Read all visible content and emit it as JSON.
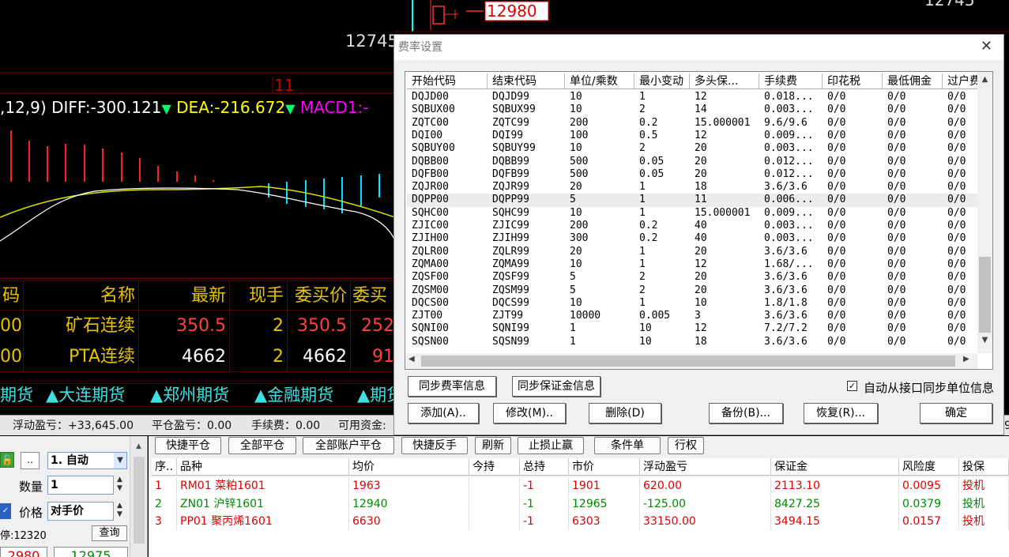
{
  "chart": {
    "price_label_top": "12745",
    "tick_label": "11",
    "top_marker": "12980",
    "top_right_value": "12745",
    "macd": {
      "params": ",12,9)",
      "diff": "DIFF:-300.121",
      "dea": "DEA:-216.672",
      "macd": "MACD1:-",
      "diff_color": "#ffffff",
      "dea_color": "#ffff00",
      "macd_color": "#ff00ff"
    }
  },
  "quotes": {
    "headers": [
      "码",
      "名称",
      "最新",
      "现手",
      "委买价",
      "委买"
    ],
    "rows": [
      {
        "code": "00",
        "name": "矿石连续",
        "last": "350.5",
        "hand": "2",
        "bid": "350.5",
        "bidvol": "252"
      },
      {
        "code": "00",
        "name": "PTA连续",
        "last": "4662",
        "hand": "2",
        "bid": "4662",
        "bidvol": "91"
      }
    ]
  },
  "exchanges": [
    "期货",
    "▲大连期货",
    "▲郑州期货",
    "▲金融期货",
    "▲期货"
  ],
  "status": {
    "float_pnl": "浮动盈亏：+33,645.00",
    "close_pnl": "平仓盈亏：0.00",
    "fee": "手续费：0.00",
    "available": "可用资金:",
    "tail": "9"
  },
  "order_panel": {
    "mode": "1. 自动",
    "qty_label": "数量",
    "qty_value": "1",
    "price_label": "价格",
    "price_value": "对手价",
    "limit_label": "停:12320",
    "query_button": "查询",
    "bid_price": "2980",
    "ask_price": "12975",
    "dots_button": ".."
  },
  "positions": {
    "buttons": [
      "快捷平仓",
      "全部平仓",
      "全部账户平仓",
      "快捷反手",
      "刷新",
      "止损止赢",
      "条件单",
      "行权"
    ],
    "headers": [
      "序..",
      "品种",
      "均价",
      "今持",
      "总持",
      "市价",
      "浮动盈亏",
      "保证金",
      "风险度",
      "投保"
    ],
    "rows": [
      {
        "idx": "1",
        "name": "RM01 菜粕1601",
        "avg": "1963",
        "today": "",
        "total": "-1",
        "market": "1901",
        "pnl": "620.00",
        "margin": "2113.10",
        "risk": "0.0095",
        "hedge": "投机",
        "color": "#e00000"
      },
      {
        "idx": "2",
        "name": "ZN01 沪锌1601",
        "avg": "12940",
        "today": "",
        "total": "-1",
        "market": "12965",
        "pnl": "-125.00",
        "margin": "8427.25",
        "risk": "0.0379",
        "hedge": "投机",
        "color": "#008a00"
      },
      {
        "idx": "3",
        "name": "PP01 聚丙烯1601",
        "avg": "6630",
        "today": "",
        "total": "-1",
        "market": "6303",
        "pnl": "33150.00",
        "margin": "3494.15",
        "risk": "0.0157",
        "hedge": "投机",
        "color": "#e00000"
      }
    ]
  },
  "dialog": {
    "title": "费率设置",
    "close": "✕",
    "columns": [
      "开始代码",
      "结束代码",
      "单位/乘数",
      "最小变动",
      "多头保...",
      "手续费",
      "印花税",
      "最低佣金",
      "过户费"
    ],
    "rows": [
      [
        "DQJD00",
        "DQJD99",
        "10",
        "1",
        "12",
        "0.018...",
        "0/0",
        "0/0",
        "0/0"
      ],
      [
        "SQBUX00",
        "SQBUX99",
        "10",
        "2",
        "14",
        "0.003...",
        "0/0",
        "0/0",
        "0/0"
      ],
      [
        "ZQTC00",
        "ZQTC99",
        "200",
        "0.2",
        "15.000001",
        "9.6/9.6",
        "0/0",
        "0/0",
        "0/0"
      ],
      [
        "DQI00",
        "DQI99",
        "100",
        "0.5",
        "12",
        "0.009...",
        "0/0",
        "0/0",
        "0/0"
      ],
      [
        "SQBUY00",
        "SQBUY99",
        "10",
        "2",
        "20",
        "0.003...",
        "0/0",
        "0/0",
        "0/0"
      ],
      [
        "DQBB00",
        "DQBB99",
        "500",
        "0.05",
        "20",
        "0.012...",
        "0/0",
        "0/0",
        "0/0"
      ],
      [
        "DQFB00",
        "DQFB99",
        "500",
        "0.05",
        "20",
        "0.012...",
        "0/0",
        "0/0",
        "0/0"
      ],
      [
        "ZQJR00",
        "ZQJR99",
        "20",
        "1",
        "18",
        "3.6/3.6",
        "0/0",
        "0/0",
        "0/0"
      ],
      [
        "DQPP00",
        "DQPP99",
        "5",
        "1",
        "11",
        "0.006...",
        "0/0",
        "0/0",
        "0/0"
      ],
      [
        "SQHC00",
        "SQHC99",
        "10",
        "1",
        "15.000001",
        "0.009...",
        "0/0",
        "0/0",
        "0/0"
      ],
      [
        "ZJIC00",
        "ZJIC99",
        "200",
        "0.2",
        "40",
        "0.003...",
        "0/0",
        "0/0",
        "0/0"
      ],
      [
        "ZJIH00",
        "ZJIH99",
        "300",
        "0.2",
        "40",
        "0.003...",
        "0/0",
        "0/0",
        "0/0"
      ],
      [
        "ZQLR00",
        "ZQLR99",
        "20",
        "1",
        "20",
        "3.6/3.6",
        "0/0",
        "0/0",
        "0/0"
      ],
      [
        "ZQMA00",
        "ZQMA99",
        "10",
        "1",
        "12",
        "1.68/...",
        "0/0",
        "0/0",
        "0/0"
      ],
      [
        "ZQSF00",
        "ZQSF99",
        "5",
        "2",
        "20",
        "3.6/3.6",
        "0/0",
        "0/0",
        "0/0"
      ],
      [
        "ZQSM00",
        "ZQSM99",
        "5",
        "2",
        "20",
        "3.6/3.6",
        "0/0",
        "0/0",
        "0/0"
      ],
      [
        "DQCS00",
        "DQCS99",
        "10",
        "1",
        "10",
        "1.8/1.8",
        "0/0",
        "0/0",
        "0/0"
      ],
      [
        "ZJT00",
        "ZJT99",
        "10000",
        "0.005",
        "3",
        "3.6/3.6",
        "0/0",
        "0/0",
        "0/0"
      ],
      [
        "SQNI00",
        "SQNI99",
        "1",
        "10",
        "12",
        "7.2/7.2",
        "0/0",
        "0/0",
        "0/0"
      ],
      [
        "SQSN00",
        "SQSN99",
        "1",
        "10",
        "18",
        "3.6/3.6",
        "0/0",
        "0/0",
        "0/0"
      ]
    ],
    "highlight_row": 8,
    "sync_rate_button": "同步费率信息",
    "sync_margin_button": "同步保证金信息",
    "auto_sync_label": "自动从接口同步单位信息",
    "auto_sync_checked": true,
    "add_button": "添加(A)..",
    "edit_button": "修改(M)..",
    "delete_button": "删除(D)",
    "backup_button": "备份(B)...",
    "restore_button": "恢复(R)...",
    "ok_button": "确定"
  }
}
